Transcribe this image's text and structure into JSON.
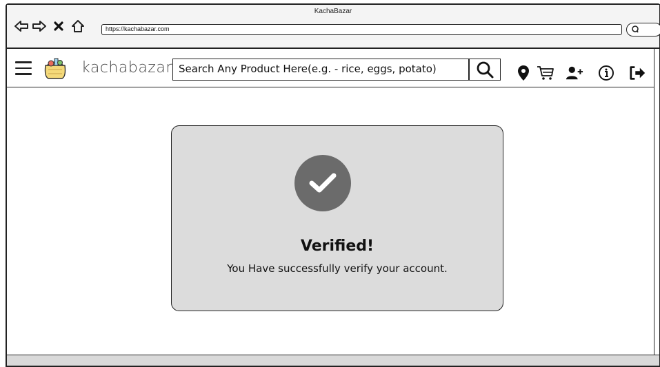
{
  "browser": {
    "window_title": "KachaBazar",
    "url": "https://kachabazar.com"
  },
  "header": {
    "brand": "kachabazar",
    "search_placeholder": "Search Any Product Here(e.g. - rice, eggs, potato)",
    "icons": [
      "menu-icon",
      "logo-icon",
      "search-icon",
      "location-icon",
      "cart-icon",
      "add-user-icon",
      "info-icon",
      "logout-icon"
    ]
  },
  "verification": {
    "title": "Verified!",
    "message": "You Have successfully verify your account."
  },
  "colors": {
    "card_bg": "#dcdcdc",
    "check_circle": "#6b6b6b",
    "bottom_bar": "#d9d9d9"
  }
}
